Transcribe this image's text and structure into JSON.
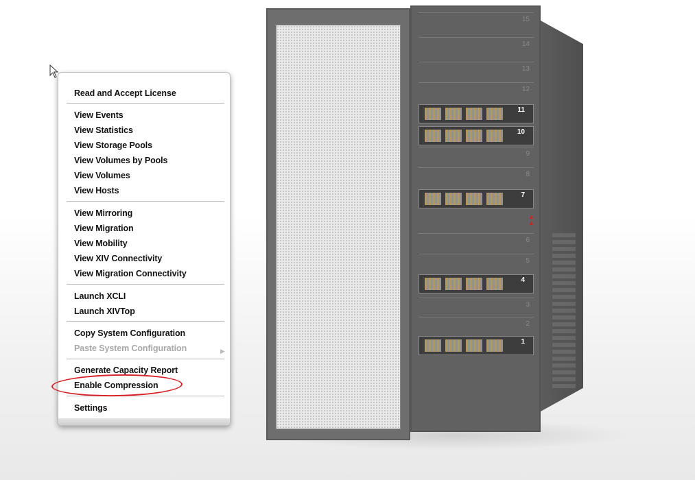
{
  "context_menu": {
    "items": [
      {
        "label": "Read and Accept License"
      },
      {
        "label": "View Events"
      },
      {
        "label": "View Statistics"
      },
      {
        "label": "View Storage Pools"
      },
      {
        "label": "View Volumes by Pools"
      },
      {
        "label": "View Volumes"
      },
      {
        "label": "View Hosts"
      },
      {
        "label": "View Mirroring"
      },
      {
        "label": "View Migration"
      },
      {
        "label": "View Mobility"
      },
      {
        "label": "View XIV Connectivity"
      },
      {
        "label": "View Migration Connectivity"
      },
      {
        "label": "Launch XCLI"
      },
      {
        "label": "Launch XIVTop"
      },
      {
        "label": "Copy System Configuration"
      },
      {
        "label": "Paste System Configuration",
        "disabled": true
      },
      {
        "label": "Generate Capacity Report"
      },
      {
        "label": "Enable Compression",
        "highlighted": true
      },
      {
        "label": "Settings"
      }
    ]
  },
  "rack": {
    "slot_numbers": [
      "15",
      "14",
      "13",
      "12",
      "11",
      "10",
      "9",
      "8",
      "7",
      "6",
      "5",
      "4",
      "3",
      "2",
      "1"
    ],
    "installed_modules": [
      "11",
      "10",
      "7",
      "4",
      "1"
    ]
  },
  "colors": {
    "highlight": "#d8232a",
    "menu_text": "#111111",
    "disabled_text": "#a8a8a8"
  }
}
